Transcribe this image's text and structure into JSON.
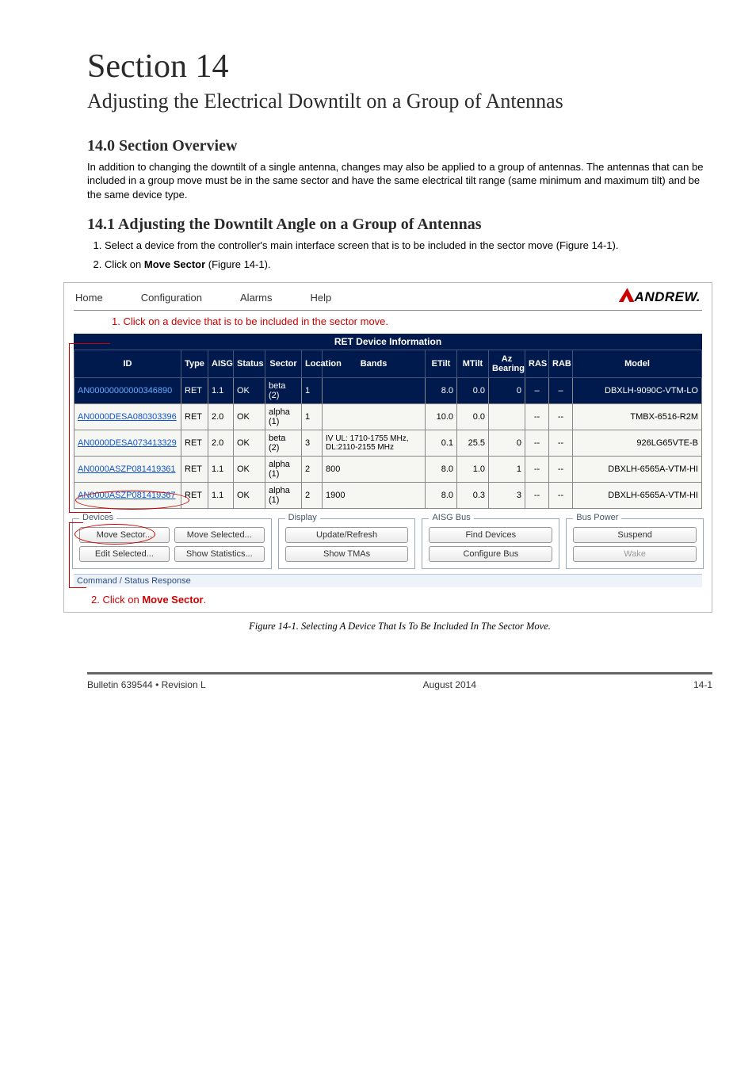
{
  "section_number": "Section 14",
  "section_heading": "Adjusting the Electrical Downtilt on a Group of Antennas",
  "overview_heading": "14.0 Section Overview",
  "overview_body": "In addition to changing the downtilt of a single antenna, changes may also be applied to a group of antennas. The antennas that can be included in a group move must be in the same sector and have the same electrical tilt range (same minimum and maximum tilt) and be the same device type.",
  "adjust_heading": "14.1 Adjusting the Downtilt Angle on a Group of Antennas",
  "steps": {
    "s1": "Select a device from the controller's main interface screen that is to be included in the sector move (Figure 14-1).",
    "s2_pre": "Click on ",
    "s2_bold": "Move Sector",
    "s2_post": " (Figure 14-1)."
  },
  "menu": {
    "home": "Home",
    "configuration": "Configuration",
    "alarms": "Alarms",
    "help": "Help"
  },
  "logo_text": "ANDREW.",
  "annotation1": "1.  Click on a device that is to be included in the sector move.",
  "annotation2_pre": "2.  Click on ",
  "annotation2_bold": "Move Sector",
  "annotation2_post": ".",
  "table_title": "RET Device Information",
  "headers": {
    "id": "ID",
    "type": "Type",
    "aisg": "AISG",
    "status": "Status",
    "sector": "Sector",
    "location": "Location",
    "bands": "Bands",
    "etilt": "ETilt",
    "mtilt": "MTilt",
    "az": "Az Bearing",
    "ras": "RAS",
    "rab": "RAB",
    "model": "Model"
  },
  "rows": [
    {
      "id": "AN00000000000346890",
      "type": "RET",
      "aisg": "1.1",
      "status": "OK",
      "sector": "beta (2)",
      "location": "1",
      "bands": "",
      "etilt": "8.0",
      "mtilt": "0.0",
      "az": "0",
      "ras": "–",
      "rab": "–",
      "model": "DBXLH-9090C-VTM-LO"
    },
    {
      "id": "AN0000DESA080303396",
      "type": "RET",
      "aisg": "2.0",
      "status": "OK",
      "sector": "alpha (1)",
      "location": "1",
      "bands": "",
      "etilt": "10.0",
      "mtilt": "0.0",
      "az": "",
      "ras": "--",
      "rab": "--",
      "model": "TMBX-6516-R2M"
    },
    {
      "id": "AN0000DESA073413329",
      "type": "RET",
      "aisg": "2.0",
      "status": "OK",
      "sector": "beta (2)",
      "location": "3",
      "bands": "IV UL: 1710-1755 MHz, DL:2110-2155 MHz",
      "etilt": "0.1",
      "mtilt": "25.5",
      "az": "0",
      "ras": "--",
      "rab": "--",
      "model": "926LG65VTE-B"
    },
    {
      "id": "AN0000ASZP081419361",
      "type": "RET",
      "aisg": "1.1",
      "status": "OK",
      "sector": "alpha (1)",
      "location": "2",
      "bands": "800",
      "etilt": "8.0",
      "mtilt": "1.0",
      "az": "1",
      "ras": "--",
      "rab": "--",
      "model": "DBXLH-6565A-VTM-HI"
    },
    {
      "id": "AN0000ASZP081419367",
      "type": "RET",
      "aisg": "1.1",
      "status": "OK",
      "sector": "alpha (1)",
      "location": "2",
      "bands": "1900",
      "etilt": "8.0",
      "mtilt": "0.3",
      "az": "3",
      "ras": "--",
      "rab": "--",
      "model": "DBXLH-6565A-VTM-HI"
    }
  ],
  "groupboxes": {
    "devices": {
      "legend": "Devices",
      "move_sector": "Move Sector...",
      "edit_selected": "Edit Selected...",
      "move_selected": "Move Selected...",
      "show_stats": "Show Statistics..."
    },
    "display": {
      "legend": "Display",
      "update": "Update/Refresh",
      "show_tmas": "Show TMAs"
    },
    "aisg": {
      "legend": "AISG Bus",
      "find": "Find Devices",
      "configure": "Configure Bus"
    },
    "power": {
      "legend": "Bus Power",
      "suspend": "Suspend",
      "wake": "Wake"
    }
  },
  "status_label": "Command / Status Response",
  "figure_caption": "Figure 14-1.  Selecting A Device That Is To Be Included In The Sector Move.",
  "footer": {
    "left": "Bulletin 639544  •  Revision L",
    "center": "August 2014",
    "right": "14-1"
  }
}
